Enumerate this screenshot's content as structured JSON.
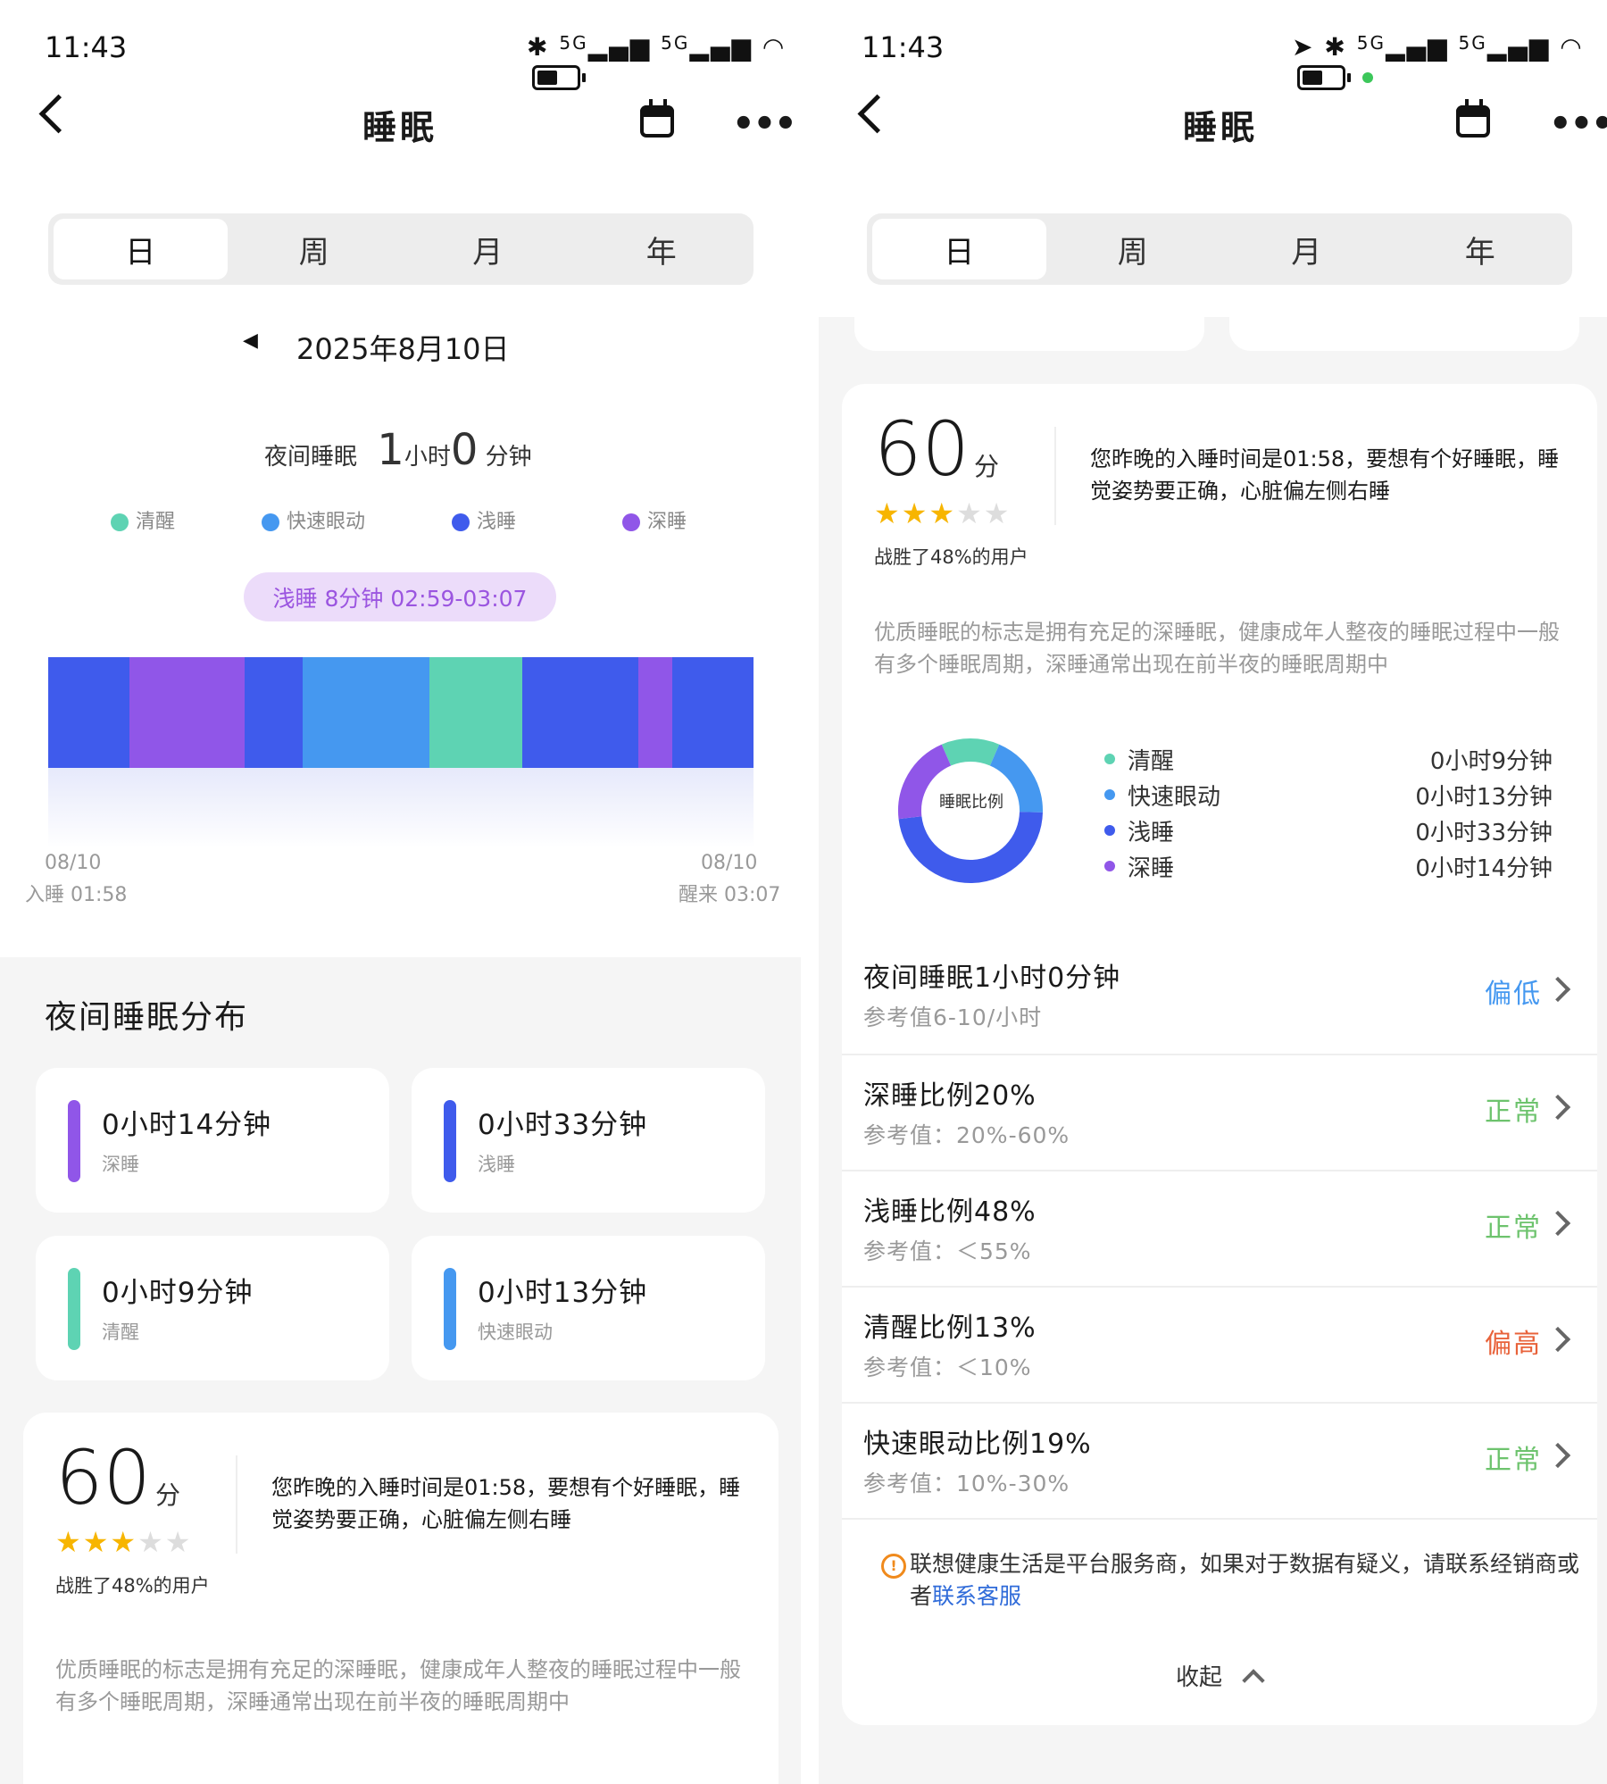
{
  "status": {
    "time": "11:43",
    "network": "5G"
  },
  "header": {
    "title": "睡眠"
  },
  "tabs": [
    "日",
    "周",
    "月",
    "年"
  ],
  "date_nav": {
    "date": "2025年8月10日"
  },
  "night_sleep": {
    "label": "夜间睡眠",
    "hours": "1",
    "hours_unit": "小时",
    "minutes": "0",
    "minutes_unit": "分钟"
  },
  "legend": [
    {
      "label": "清醒",
      "color": "#5ed3b3"
    },
    {
      "label": "快速眼动",
      "color": "#4598f0"
    },
    {
      "label": "浅睡",
      "color": "#3f5bec"
    },
    {
      "label": "深睡",
      "color": "#9056e8"
    }
  ],
  "tooltip": "浅睡 8分钟 02:59-03:07",
  "timeline": {
    "segments": [
      {
        "stage": "浅睡",
        "color": "#3f5bec",
        "minutes": 7
      },
      {
        "stage": "深睡",
        "color": "#9056e8",
        "minutes": 10
      },
      {
        "stage": "浅睡",
        "color": "#3f5bec",
        "minutes": 5
      },
      {
        "stage": "快速眼动",
        "color": "#4598f0",
        "minutes": 11
      },
      {
        "stage": "清醒",
        "color": "#5ed3b3",
        "minutes": 8
      },
      {
        "stage": "浅睡",
        "color": "#3f5bec",
        "minutes": 10
      },
      {
        "stage": "深睡",
        "color": "#9056e8",
        "minutes": 3
      },
      {
        "stage": "浅睡",
        "color": "#3f5bec",
        "minutes": 7
      }
    ],
    "start_date": "08/10",
    "start_label": "入睡 01:58",
    "end_date": "08/10",
    "end_label": "醒来 03:07"
  },
  "distribution": {
    "title": "夜间睡眠分布",
    "items": [
      {
        "value": "0小时14分钟",
        "label": "深睡",
        "color": "#9056e8"
      },
      {
        "value": "0小时33分钟",
        "label": "浅睡",
        "color": "#3f5bec"
      },
      {
        "value": "0小时9分钟",
        "label": "清醒",
        "color": "#5ed3b3"
      },
      {
        "value": "0小时13分钟",
        "label": "快速眼动",
        "color": "#4598f0"
      }
    ]
  },
  "score": {
    "value": "60",
    "unit": "分",
    "stars": 3,
    "max_stars": 5,
    "beat": "战胜了48%的用户",
    "advice": "您昨晚的入睡时间是01:58，要想有个好睡眠，睡觉姿势要正确，心脏偏左侧右睡",
    "tip": "优质睡眠的标志是拥有充足的深睡眠，健康成年人整夜的睡眠过程中一般有多个睡眠周期，深睡通常出现在前半夜的睡眠周期中"
  },
  "ratio": {
    "center": "睡眠比例",
    "items": [
      {
        "label": "清醒",
        "value": "0小时9分钟",
        "minutes": 9,
        "color": "#5ed3b3"
      },
      {
        "label": "快速眼动",
        "value": "0小时13分钟",
        "minutes": 13,
        "color": "#4598f0"
      },
      {
        "label": "浅睡",
        "value": "0小时33分钟",
        "minutes": 33,
        "color": "#3f5bec"
      },
      {
        "label": "深睡",
        "value": "0小时14分钟",
        "minutes": 14,
        "color": "#9056e8"
      }
    ]
  },
  "metrics": [
    {
      "title": "夜间睡眠1小时0分钟",
      "ref": "参考值6-10/小时",
      "status": "偏低",
      "color": "#4598f0"
    },
    {
      "title": "深睡比例20%",
      "ref": "参考值：20%-60%",
      "status": "正常",
      "color": "#6dc36d"
    },
    {
      "title": "浅睡比例48%",
      "ref": "参考值：＜55%",
      "status": "正常",
      "color": "#6dc36d"
    },
    {
      "title": "清醒比例13%",
      "ref": "参考值：＜10%",
      "status": "偏高",
      "color": "#e8623a"
    },
    {
      "title": "快速眼动比例19%",
      "ref": "参考值：10%-30%",
      "status": "正常",
      "color": "#6dc36d"
    }
  ],
  "notice": {
    "text": "联想健康生活是平台服务商，如果对于数据有疑义，请联系经销商或者",
    "link": "联系客服"
  },
  "collapse": "收起"
}
